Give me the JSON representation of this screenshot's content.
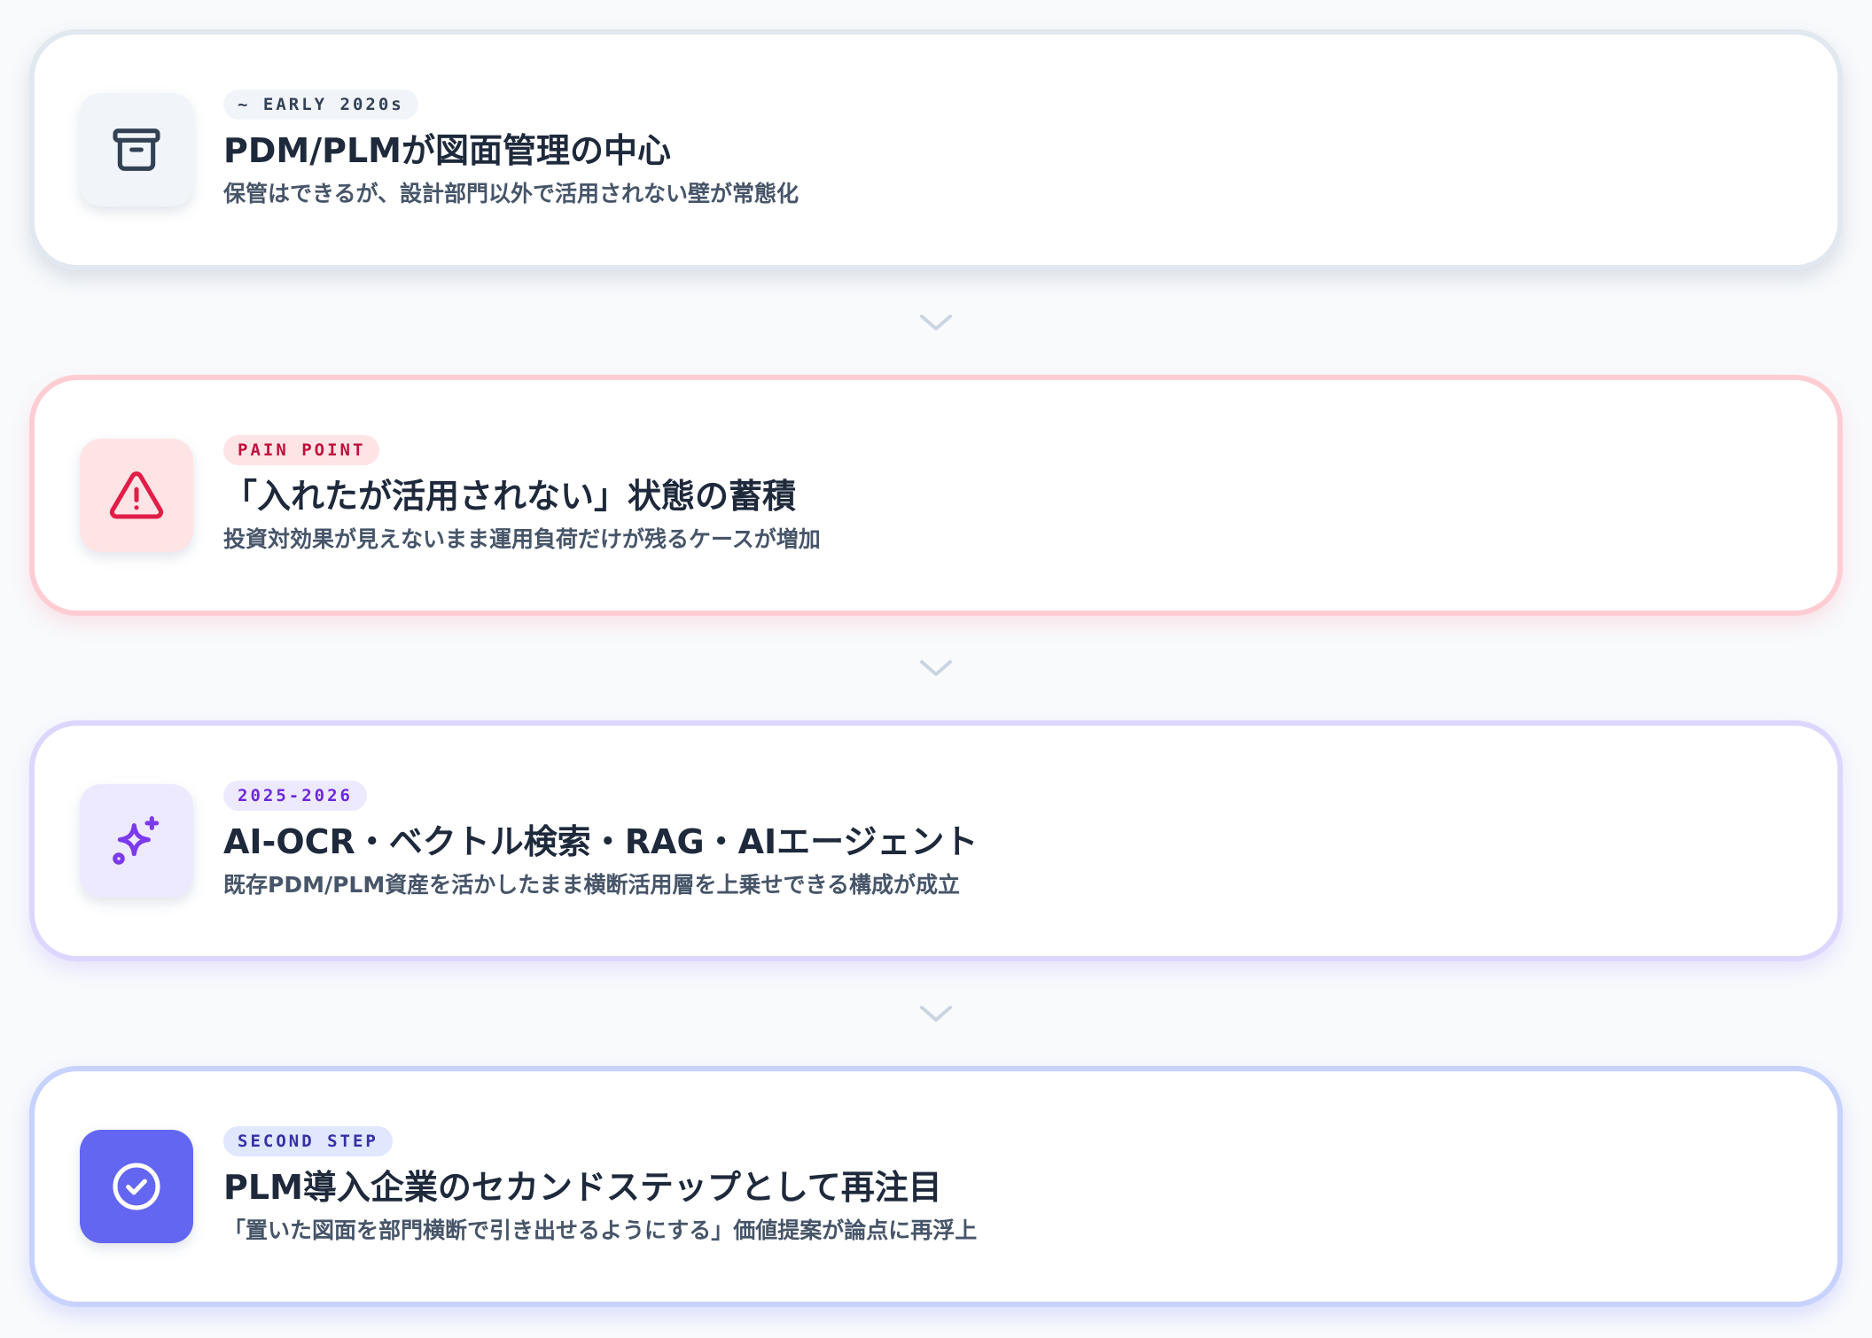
{
  "steps": [
    {
      "badge": "~ EARLY 2020s",
      "title": "PDM/PLMが図面管理の中心",
      "description": "保管はできるが、設計部門以外で活用されない壁が常態化",
      "icon": "archive-box-icon",
      "accent": "#334155"
    },
    {
      "badge": "PAIN POINT",
      "title": "「入れたが活用されない」状態の蓄積",
      "description": "投資対効果が見えないまま運用負荷だけが残るケースが増加",
      "icon": "warning-triangle-icon",
      "accent": "#e11d48"
    },
    {
      "badge": "2025-2026",
      "title": "AI-OCR・ベクトル検索・RAG・AIエージェント",
      "description": "既存PDM/PLM資産を活かしたまま横断活用層を上乗せできる構成が成立",
      "icon": "sparkles-icon",
      "accent": "#7c3aed"
    },
    {
      "badge": "SECOND STEP",
      "title": "PLM導入企業のセカンドステップとして再注目",
      "description": "「置いた図面を部門横断で引き出せるようにする」価値提案が論点に再浮上",
      "icon": "check-circle-icon",
      "accent": "#6366f1"
    }
  ]
}
